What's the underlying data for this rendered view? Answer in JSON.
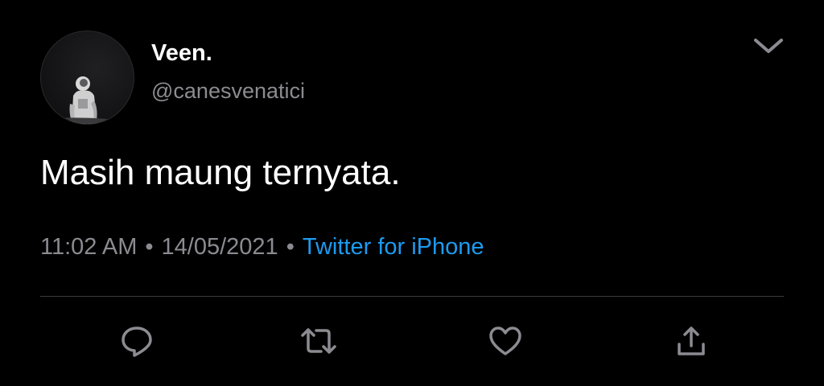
{
  "user": {
    "display_name": "Veen.",
    "handle": "@canesvenatici"
  },
  "tweet": {
    "text": "Masih maung ternyata.",
    "time": "11:02 AM",
    "separator": "•",
    "date": "14/05/2021",
    "source": "Twitter for iPhone"
  },
  "icons": {
    "menu": "chevron-down-icon",
    "actions": [
      "reply-icon",
      "retweet-icon",
      "like-icon",
      "share-icon"
    ]
  },
  "colors": {
    "background": "#000000",
    "primary_text": "#ffffff",
    "secondary_text": "#8b8b91",
    "link": "#1d9bf0",
    "divider": "#3a3a3c"
  }
}
